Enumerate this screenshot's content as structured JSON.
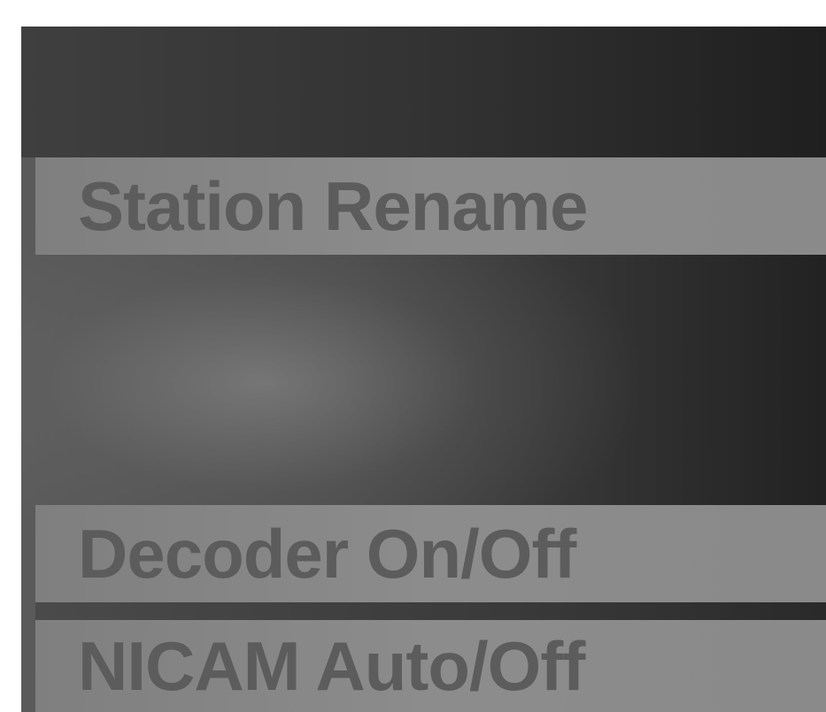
{
  "menu": {
    "items": [
      {
        "label": "Station Rename"
      },
      {
        "label": "Decoder On/Off"
      },
      {
        "label": "NICAM Auto/Off"
      }
    ]
  }
}
